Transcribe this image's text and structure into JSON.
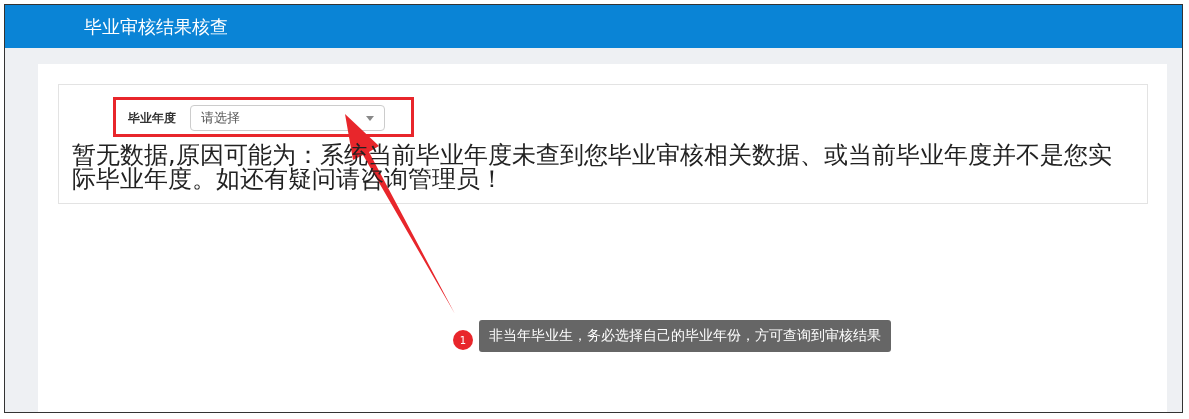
{
  "header": {
    "title": "毕业审核结果核查"
  },
  "filter": {
    "label": "毕业年度",
    "select": {
      "placeholder": "请选择"
    }
  },
  "message": "暂无数据,原因可能为：系统当前毕业年度未查到您毕业审核相关数据、或当前毕业年度并不是您实际毕业年度。如还有疑问请咨询管理员！",
  "annotation": {
    "number": "1",
    "note": "非当年毕业生，务必选择自己的毕业年份，方可查询到审核结果"
  }
}
